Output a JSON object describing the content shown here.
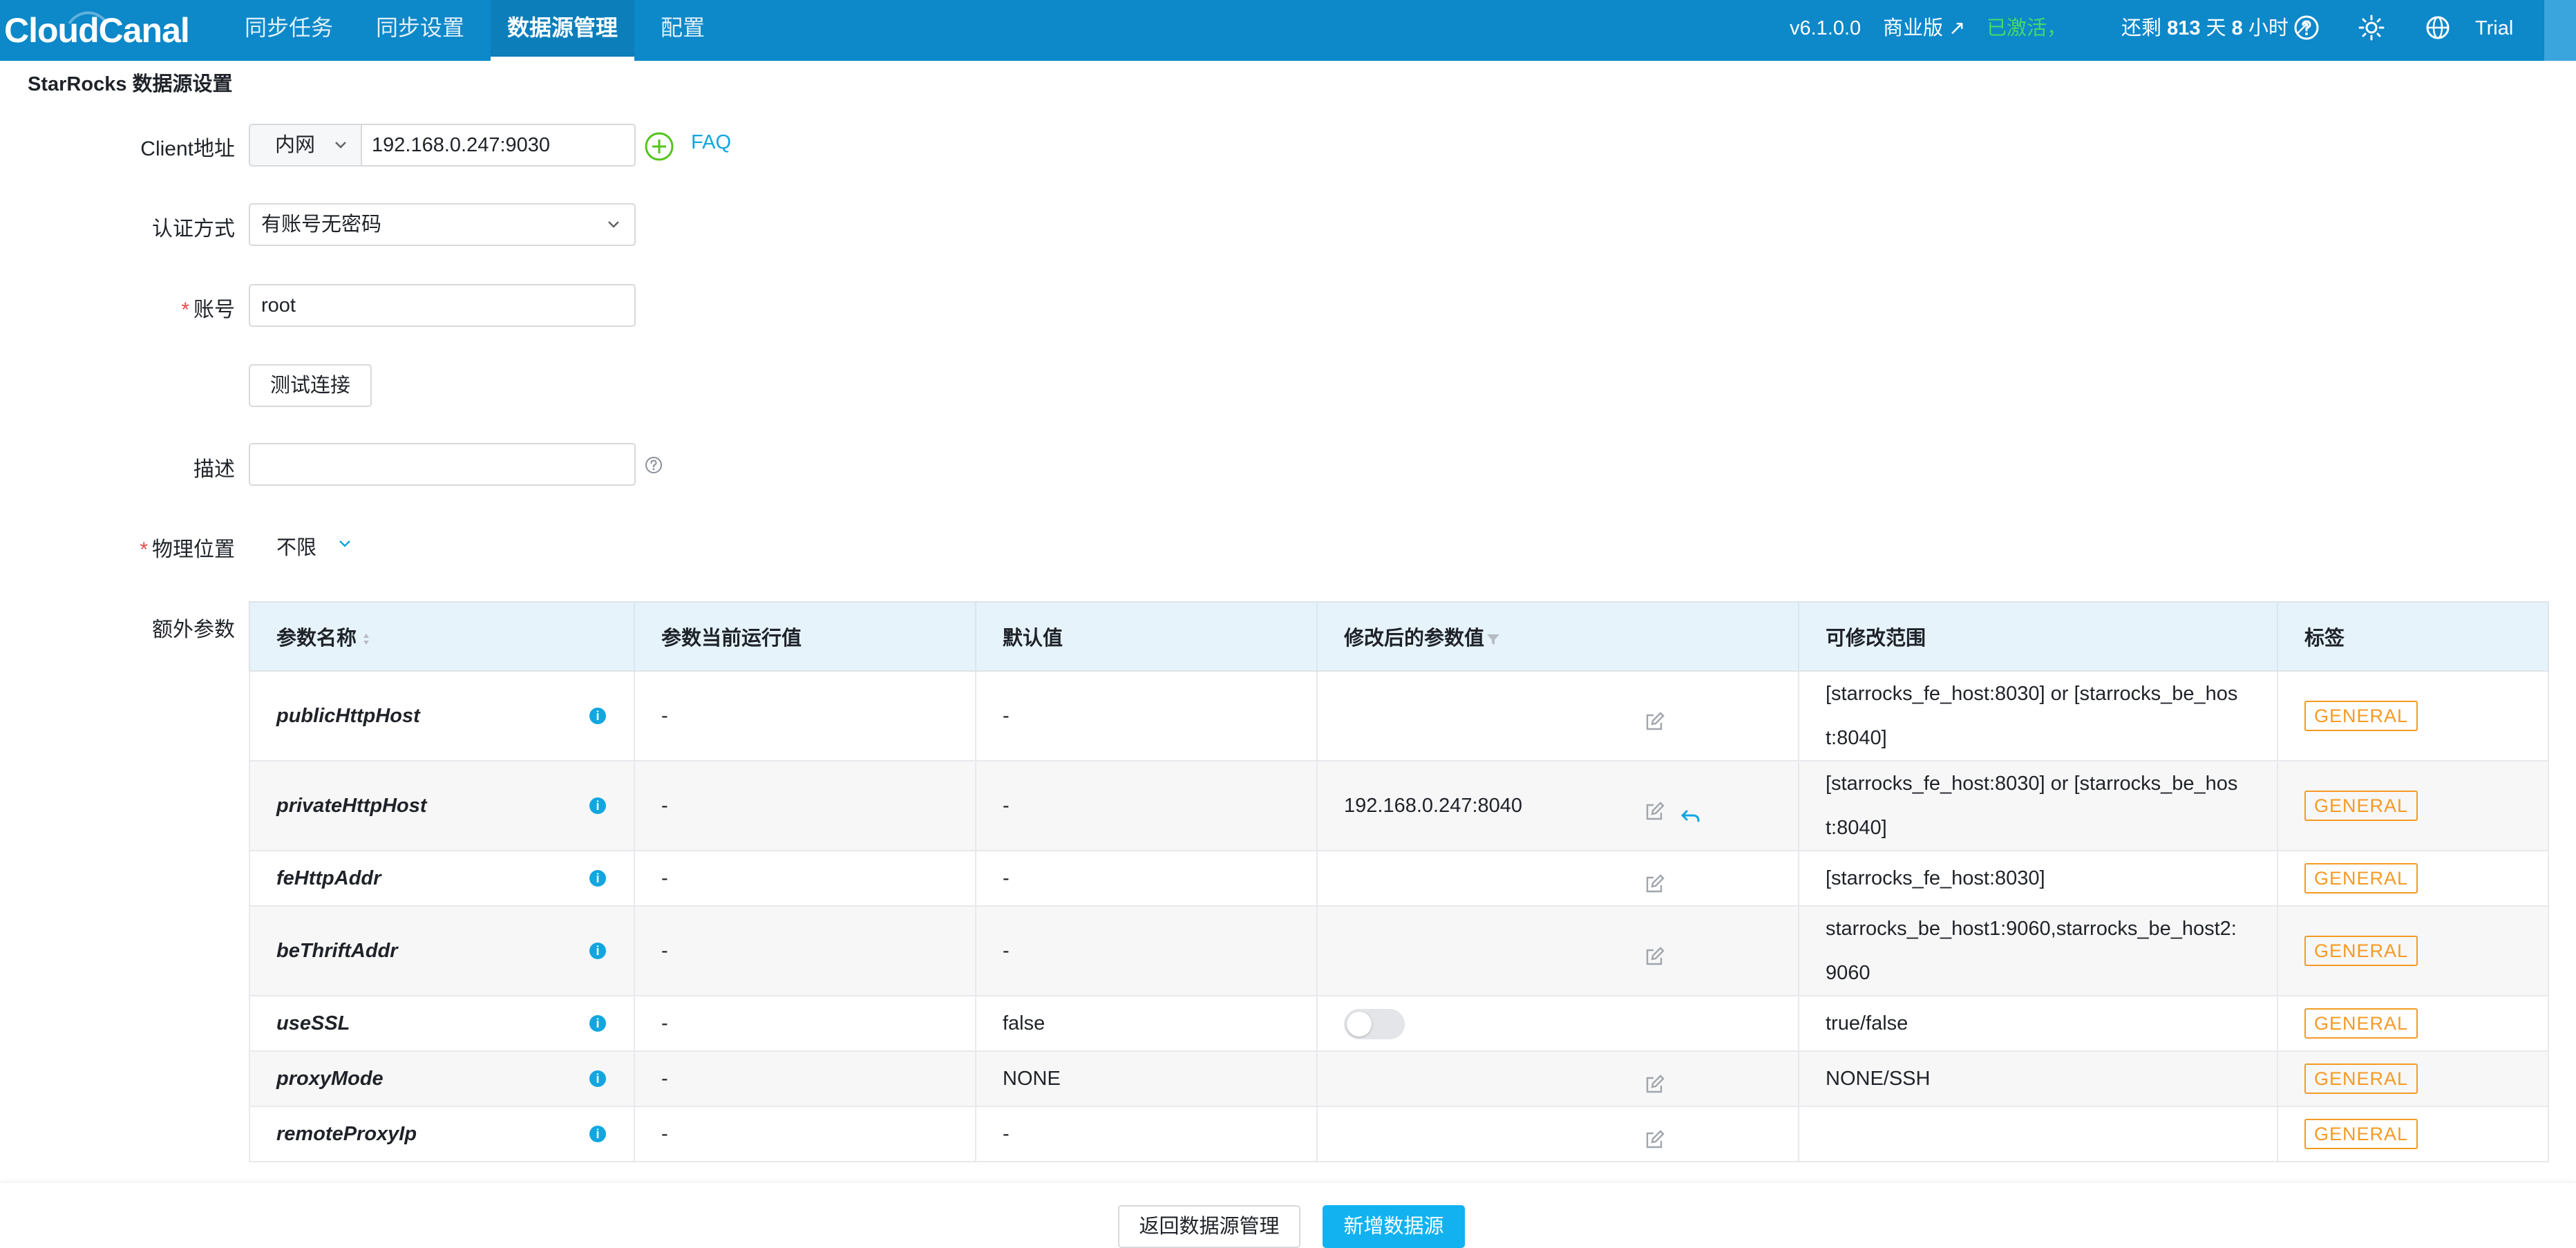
{
  "app": {
    "logo_text": "CloudCanal"
  },
  "nav": {
    "items": [
      {
        "label": "同步任务"
      },
      {
        "label": "同步设置"
      },
      {
        "label": "数据源管理",
        "active": true
      },
      {
        "label": "配置"
      }
    ]
  },
  "topbar": {
    "version": "v6.1.0.0",
    "edition": "商业版 ↗",
    "activated": "已激活，",
    "remain_prefix": "还剩",
    "remain_days": "813",
    "remain_days_unit": "天",
    "remain_hours": "8",
    "remain_hours_unit": "小时 ↗",
    "trial": "Trial",
    "icons": [
      "help-icon",
      "theme-sun-icon",
      "language-globe-icon"
    ]
  },
  "page": {
    "title": "StarRocks 数据源设置"
  },
  "form": {
    "client_label": "Client地址",
    "client_network": "内网",
    "client_address": "192.168.0.247:9030",
    "faq": "FAQ",
    "auth_label": "认证方式",
    "auth_value": "有账号无密码",
    "account_label": "账号",
    "account_value": "root",
    "test_button": "测试连接",
    "desc_label": "描述",
    "desc_value": "",
    "location_label": "物理位置",
    "location_value": "不限",
    "extra_label": "额外参数",
    "required_mark": "*"
  },
  "table": {
    "headers": [
      "参数名称",
      "参数当前运行值",
      "默认值",
      "修改后的参数值",
      "可修改范围",
      "标签"
    ],
    "rows": [
      {
        "name": "publicHttpHost",
        "current": "-",
        "default": "-",
        "modified": "",
        "range_line1": "[starrocks_fe_host:8030] or [starrocks_be_hos",
        "range_line2": "t:8040]",
        "tag": "GENERAL"
      },
      {
        "name": "privateHttpHost",
        "current": "-",
        "default": "-",
        "modified": "192.168.0.247:8040",
        "range_line1": "[starrocks_fe_host:8030] or [starrocks_be_hos",
        "range_line2": "t:8040]",
        "tag": "GENERAL"
      },
      {
        "name": "feHttpAddr",
        "current": "-",
        "default": "-",
        "modified": "",
        "range_line1": "[starrocks_fe_host:8030]",
        "range_line2": "",
        "tag": "GENERAL"
      },
      {
        "name": "beThriftAddr",
        "current": "-",
        "default": "-",
        "modified": "",
        "range_line1": "starrocks_be_host1:9060,starrocks_be_host2:",
        "range_line2": "9060",
        "tag": "GENERAL"
      },
      {
        "name": "useSSL",
        "current": "-",
        "default": "false",
        "modified": "",
        "range_line1": "true/false",
        "range_line2": "",
        "tag": "GENERAL"
      },
      {
        "name": "proxyMode",
        "current": "-",
        "default": "NONE",
        "modified": "",
        "range_line1": "NONE/SSH",
        "range_line2": "",
        "tag": "GENERAL"
      },
      {
        "name": "remoteProxyIp",
        "current": "-",
        "default": "-",
        "modified": "",
        "range_line1": "",
        "range_line2": "",
        "tag": "GENERAL"
      }
    ]
  },
  "footer": {
    "back_button": "返回数据源管理",
    "add_button": "新增数据源"
  },
  "colors": {
    "topbar": "#0d88c9",
    "accent": "#12a6e0",
    "primary_button": "#12b2f0",
    "activated": "#45d96b",
    "tag": "#f59a23",
    "table_header": "#e6f3fb",
    "required": "#e84b4b"
  }
}
